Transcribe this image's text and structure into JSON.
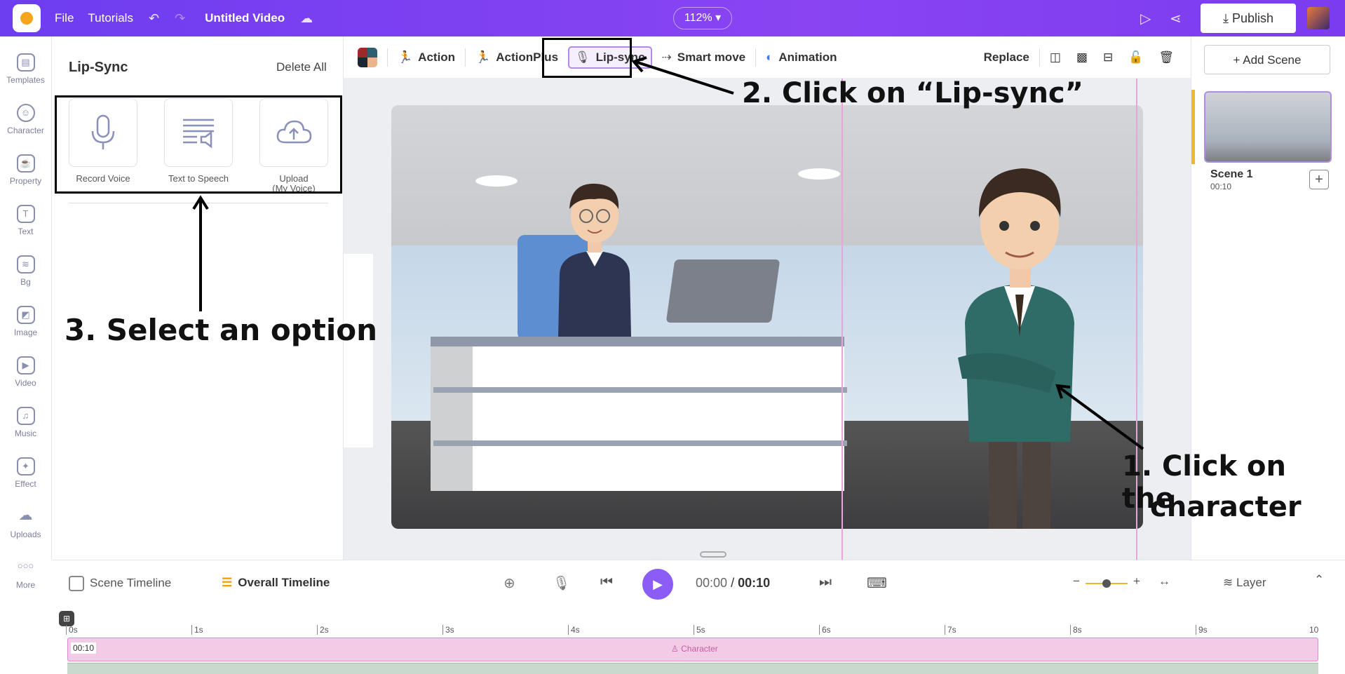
{
  "topbar": {
    "file_label": "File",
    "tutorials_label": "Tutorials",
    "project_title": "Untitled Video",
    "zoom_level": "112%",
    "publish_label": "Publish"
  },
  "leftnav": {
    "items": [
      {
        "label": "Templates",
        "icon": "templates-icon"
      },
      {
        "label": "Character",
        "icon": "character-icon"
      },
      {
        "label": "Property",
        "icon": "property-icon"
      },
      {
        "label": "Text",
        "icon": "text-icon"
      },
      {
        "label": "Bg",
        "icon": "bg-icon"
      },
      {
        "label": "Image",
        "icon": "image-icon"
      },
      {
        "label": "Video",
        "icon": "video-icon"
      },
      {
        "label": "Music",
        "icon": "music-icon"
      },
      {
        "label": "Effect",
        "icon": "effect-icon"
      },
      {
        "label": "Uploads",
        "icon": "uploads-icon"
      },
      {
        "label": "More",
        "icon": "more-icon"
      }
    ]
  },
  "panel": {
    "title": "Lip-Sync",
    "delete_all": "Delete All",
    "options": [
      {
        "label": "Record Voice",
        "sub": "",
        "icon": "microphone-icon"
      },
      {
        "label": "Text to Speech",
        "sub": "",
        "icon": "text-to-speech-icon"
      },
      {
        "label": "Upload",
        "sub": "(My Voice)",
        "icon": "cloud-upload-icon"
      }
    ]
  },
  "toolbar": {
    "action": "Action",
    "actionplus": "ActionPlus",
    "lipsync": "Lip-sync",
    "smartmove": "Smart move",
    "animation": "Animation",
    "replace": "Replace"
  },
  "rightpanel": {
    "add_scene": "+ Add Scene",
    "scene_name": "Scene 1",
    "scene_time": "00:10"
  },
  "timeline": {
    "scene_timeline": "Scene Timeline",
    "overall_timeline": "Overall Timeline",
    "current_time": "00:00",
    "separator": "/",
    "total_time": "00:10",
    "layer": "Layer",
    "ruler": [
      "0s",
      "1s",
      "2s",
      "3s",
      "4s",
      "5s",
      "6s",
      "7s",
      "8s",
      "9s",
      "10"
    ],
    "track_time": "00:10",
    "track_label": "Character"
  },
  "annotations": {
    "step1_line1": "1. Click on the",
    "step1_line2": "character",
    "step2": "2. Click on “Lip-sync”",
    "step3": "3. Select an option"
  },
  "colors": {
    "brand_purple": "#7b3cf0",
    "accent_lilac": "#b18be5",
    "track_pink": "#f3cbe7",
    "scene_accent": "#f2b630"
  }
}
